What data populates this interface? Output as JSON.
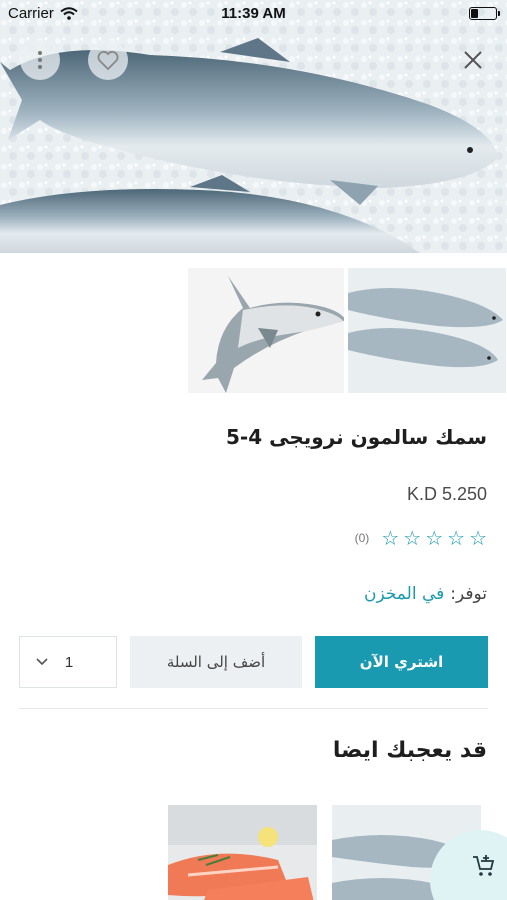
{
  "status_bar": {
    "carrier": "Carrier",
    "time": "11:39 AM",
    "battery_level": 0.3
  },
  "header": {
    "close_icon": "close-icon",
    "favorite_icon": "heart-icon",
    "more_icon": "more-vertical-icon"
  },
  "product": {
    "title": "سمك سالمون نرويجى 4-5",
    "price": "K.D 5.250",
    "rating_value": 0,
    "rating_max": 5,
    "rating_count": "(0)",
    "availability_label": "توفر:",
    "availability_value": "في المخزن"
  },
  "actions": {
    "buy_now": "اشتري الآن",
    "add_to_cart": "أضف إلى السلة",
    "quantity": "1"
  },
  "related": {
    "title": "قد يعجبك ايضا"
  },
  "colors": {
    "accent": "#1a9ab0",
    "secondary_button": "#edf0f2",
    "fab_background": "#dff3f5"
  }
}
